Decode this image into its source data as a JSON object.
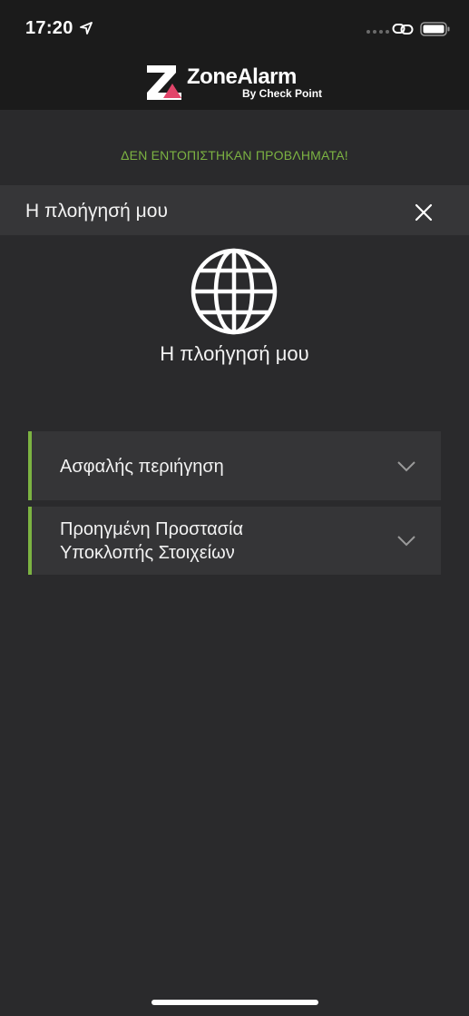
{
  "status_bar": {
    "time": "17:20",
    "icons": [
      "location-arrow-icon",
      "signal-dots-icon",
      "link-icon",
      "battery-icon"
    ]
  },
  "header": {
    "logo_brand": "ZoneAlarm",
    "logo_sub": "By Check Point",
    "logo_accent_color": "#e2456a"
  },
  "status_message": {
    "text": "ΔΕΝ ΕΝΤΟΠΙΣΤΗΚΑΝ ΠΡΟΒΛΗΜΑΤΑ!",
    "color": "#7cb342"
  },
  "section": {
    "title": "Η πλοήγησή μου",
    "close_icon": "close-icon"
  },
  "hero": {
    "icon": "globe-icon",
    "title": "Η πλοήγησή μου"
  },
  "accordion": {
    "accent_color": "#7cb342",
    "items": [
      {
        "label": "Ασφαλής περιήγηση",
        "icon": "chevron-down-icon"
      },
      {
        "label_line1": "Προηγμένη Προστασία",
        "label_line2": "Υποκλοπής Στοιχείων",
        "icon": "chevron-down-icon"
      }
    ]
  }
}
